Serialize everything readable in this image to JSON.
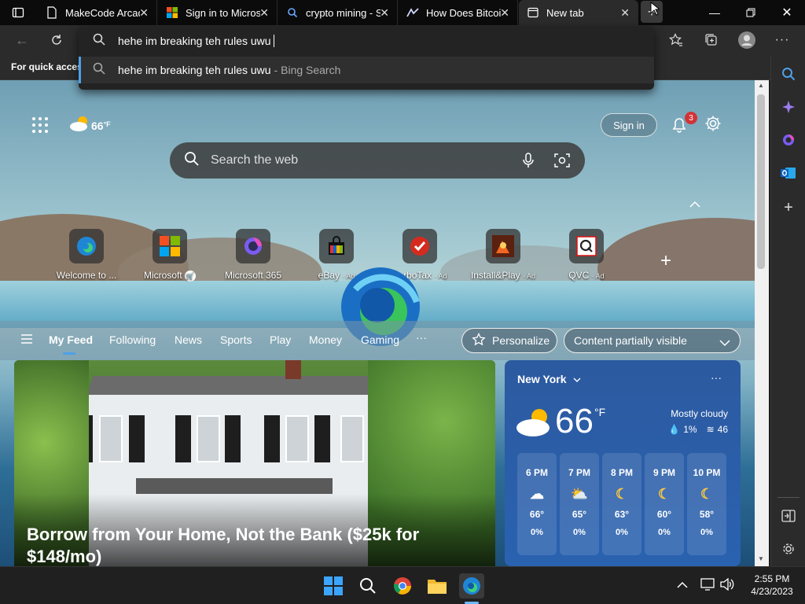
{
  "tabs": [
    {
      "title": "MakeCode Arcade",
      "icon": "doc-icon"
    },
    {
      "title": "Sign in to Microsoft",
      "icon": "microsoft-icon"
    },
    {
      "title": "crypto mining - Search",
      "icon": "search-icon"
    },
    {
      "title": "How Does Bitcoin",
      "icon": "bitcoin-site-icon"
    },
    {
      "title": "New tab",
      "icon": "newtab-icon"
    }
  ],
  "address": {
    "query": "hehe im breaking teh rules uwu",
    "suggestion": "hehe im breaking teh rules uwu",
    "suggestion_source": "- Bing Search"
  },
  "favbar_hint": "For quick access",
  "ntp": {
    "weather_mini": "66",
    "weather_mini_unit": "°F",
    "sign_in": "Sign in",
    "notif_count": "3",
    "search_placeholder": "Search the web",
    "quicklinks": [
      {
        "label": "Welcome to ...",
        "ad": ""
      },
      {
        "label": "Microsoft",
        "ad": ""
      },
      {
        "label": "Microsoft 365",
        "ad": ""
      },
      {
        "label": "eBay",
        "ad": "· Ad"
      },
      {
        "label": "TurboTax",
        "ad": "· Ad"
      },
      {
        "label": "Install&Play",
        "ad": "· Ad"
      },
      {
        "label": "QVC",
        "ad": "· Ad"
      }
    ],
    "feed_tabs": [
      "My Feed",
      "Following",
      "News",
      "Sports",
      "Play",
      "Money",
      "Gaming"
    ],
    "more": "···",
    "personalize": "Personalize",
    "content_visibility": "Content partially visible",
    "hero_headline": "Borrow from Your Home, Not the Bank ($25k for $148/mo)"
  },
  "weather": {
    "location": "New York",
    "temp": "66",
    "unit": "°F",
    "condition": "Mostly cloudy",
    "precip": "1%",
    "wind": "46",
    "hours": [
      {
        "time": "6 PM",
        "icon": "cloud-icon",
        "temp": "66°",
        "precip": "0%"
      },
      {
        "time": "7 PM",
        "icon": "partly-cloudy-icon",
        "temp": "65°",
        "precip": "0%"
      },
      {
        "time": "8 PM",
        "icon": "moon-icon",
        "temp": "63°",
        "precip": "0%"
      },
      {
        "time": "9 PM",
        "icon": "moon-icon",
        "temp": "60°",
        "precip": "0%"
      },
      {
        "time": "10 PM",
        "icon": "moon-icon",
        "temp": "58°",
        "precip": "0%"
      }
    ]
  },
  "clock": {
    "time": "2:55 PM",
    "date": "4/23/2023"
  },
  "colors": {
    "accent": "#4ea0e8",
    "notif_badge": "#d13438"
  }
}
